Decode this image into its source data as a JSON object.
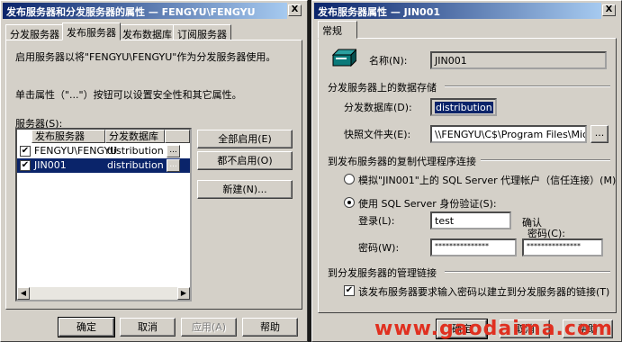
{
  "left_window": {
    "title": "发布服务器和分发服务器的属性 — FENGYU\\FENGYU",
    "close_label": "X",
    "tabs": [
      "分发服务器",
      "发布服务器",
      "发布数据库",
      "订阅服务器"
    ],
    "desc1": "启用服务器以将\"FENGYU\\FENGYU\"作为分发服务器使用。",
    "desc2": "单击属性（\"...\"）按钮可以设置安全性和其它属性。",
    "servers_label": "服务器(S):",
    "columns": [
      "发布服务器",
      "分发数据库"
    ],
    "rows": [
      {
        "checked": true,
        "server": "FENGYU\\FENGYU",
        "db": "distribution"
      },
      {
        "checked": true,
        "server": "JIN001",
        "db": "distribution"
      }
    ],
    "ellipsis": "...",
    "btn_enable_all": "全部启用(E)",
    "btn_enable_none": "都不启用(O)",
    "btn_new": "新建(N)...",
    "btn_ok": "确定",
    "btn_cancel": "取消",
    "btn_apply": "应用(A)",
    "btn_help": "帮助"
  },
  "right_window": {
    "title": "发布服务器属性 — JIN001",
    "close_label": "X",
    "tab": "常规",
    "name_label": "名称(N):",
    "name_value": "JIN001",
    "group_storage": "分发服务器上的数据存储",
    "db_label": "分发数据库(D):",
    "db_value": "distribution",
    "snapshot_label": "快照文件夹(E):",
    "snapshot_value": "\\\\FENGYU\\C$\\Program Files\\Microsoft S",
    "ellipsis": "...",
    "group_agent": "到发布服务器的复制代理程序连接",
    "radio1_label": "模拟\"JIN001\"上的 SQL Server 代理帐户（信任连接）(M)",
    "radio2_label": "使用 SQL Server 身份验证(S):",
    "login_label": "登录(L):",
    "login_value": "test",
    "confirm_label_1": "确认",
    "confirm_label_2": "密码(C):",
    "password_label": "密码(W):",
    "password_value": "***************",
    "confirm_value": "***************",
    "group_admin": "到分发服务器的管理链接",
    "admin_check_label": "该发布服务器要求输入密码以建立到分发服务器的链接(T)",
    "btn_ok": "确定",
    "btn_cancel": "取消",
    "btn_help": "帮助"
  },
  "watermark": "www.gaodaima.com"
}
